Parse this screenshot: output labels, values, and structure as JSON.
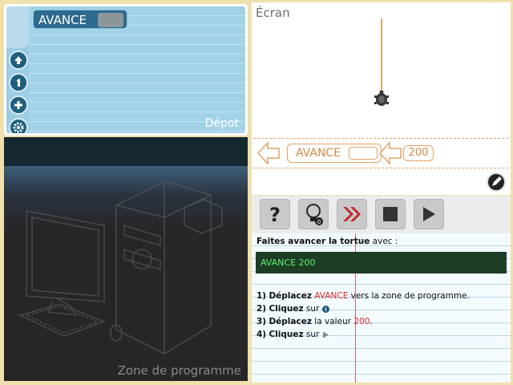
{
  "depot": {
    "label": "Dépot",
    "command_label": "AVANCE",
    "tools": [
      "upload-icon",
      "one-icon",
      "plus-icon",
      "gear-icon"
    ]
  },
  "programme": {
    "label": "Zone de programme"
  },
  "screen": {
    "title": "Écran",
    "zone_command": "AVANCE",
    "zone_value": "200"
  },
  "help": {
    "intro_bold": "Faites avancer la tortue",
    "intro_rest": " avec :",
    "code": "AVANCE 200",
    "steps": [
      {
        "num": "1)",
        "verb": "Déplacez",
        "highlight": "AVANCE",
        "rest": " vers la zone de programme."
      },
      {
        "num": "2)",
        "verb": "Cliquez",
        "rest": " sur"
      },
      {
        "num": "3)",
        "verb": "Déplacez",
        "rest": " la valeur ",
        "highlight": "200",
        "tail": "."
      },
      {
        "num": "4)",
        "verb": "Cliquez",
        "rest": " sur"
      }
    ],
    "hint_counter": "0"
  },
  "colors": {
    "accent_orange": "#e3a265",
    "depot_blue": "#9ccde4",
    "code_green": "#5cf06a",
    "highlight_red": "#e22727"
  }
}
